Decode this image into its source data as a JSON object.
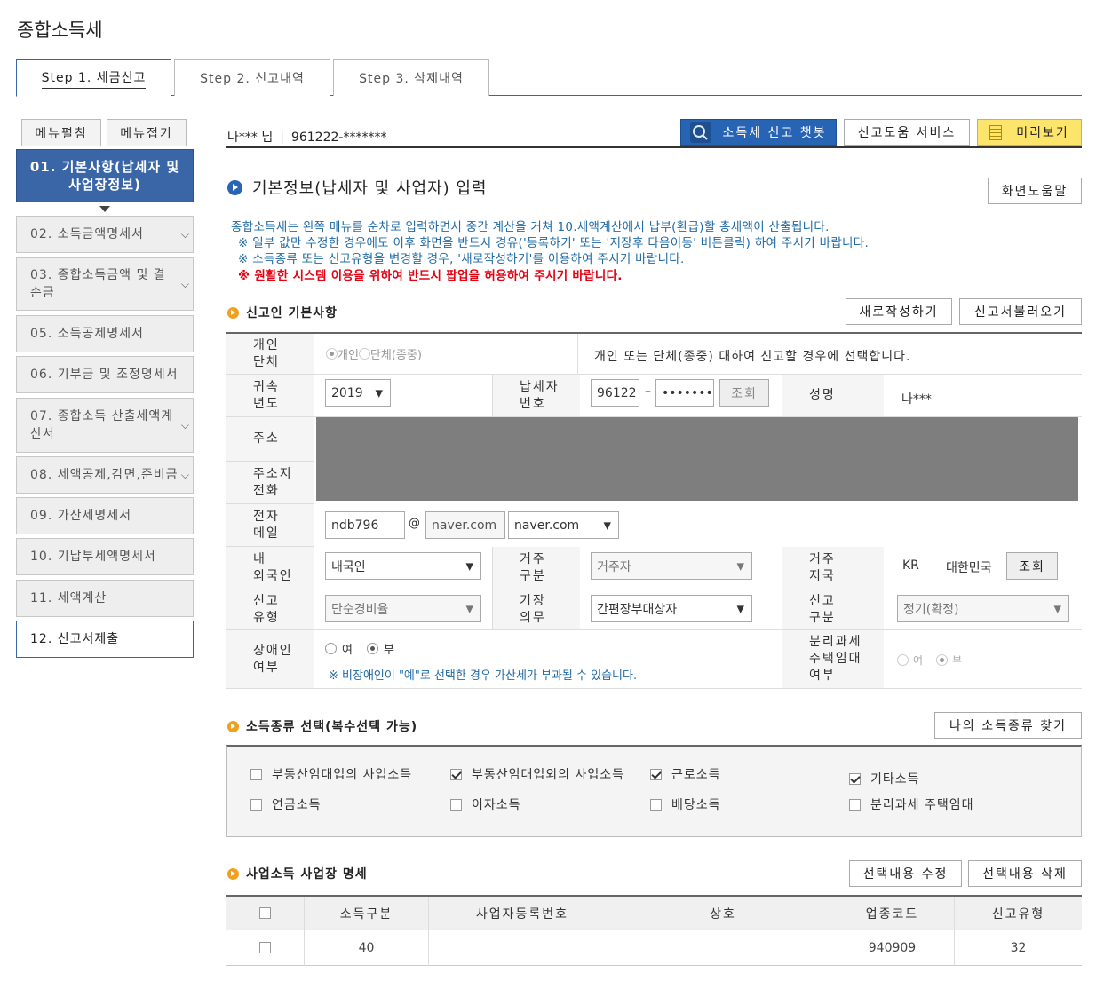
{
  "page": {
    "title": "종합소득세"
  },
  "steps": [
    "Step 1. 세금신고",
    "Step 2. 신고내역",
    "Step 3. 삭제내역"
  ],
  "sidebar": {
    "expand_all": "메뉴펼침",
    "collapse_all": "메뉴접기",
    "items": [
      {
        "label": "01. 기본사항(납세자 및 사업장정보)"
      },
      {
        "label": "02. 소득금액명세서"
      },
      {
        "label": "03. 종합소득금액 및 결손금"
      },
      {
        "label": "05. 소득공제명세서"
      },
      {
        "label": "06. 기부금 및 조정명세서"
      },
      {
        "label": "07. 종합소득 산출세액계산서"
      },
      {
        "label": "08. 세액공제,감면,준비금"
      },
      {
        "label": "09. 가산세명세서"
      },
      {
        "label": "10. 기납부세액명세서"
      },
      {
        "label": "11. 세액계산"
      },
      {
        "label": "12. 신고서제출"
      }
    ]
  },
  "userbar": {
    "name": "나***",
    "honorific": "님",
    "sep": "|",
    "id": "961222-*******"
  },
  "toolbar": {
    "chatbot": "소득세 신고 챗봇",
    "help_service": "신고도움 서비스",
    "preview": "미리보기"
  },
  "section_main": {
    "title": "기본정보(납세자 및 사업자) 입력",
    "screen_help": "화면도움말"
  },
  "notice": {
    "line1": "종합소득세는 왼쪽 메뉴를 순차로 입력하면서 중간 계산을 거쳐 10.세액계산에서 납부(환급)할 총세액이 산출됩니다.",
    "line2": "※ 일부 값만 수정한 경우에도 이후 화면을 반드시 경유('등록하기' 또는 '저장후 다음이동' 버튼클릭) 하여 주시기 바랍니다.",
    "line3": "※ 소득종류 또는 신고유형을 변경할 경우, '새로작성하기'를 이용하여 주시기 바랍니다.",
    "line4": "※ 원활한 시스템 이용을 위하여 반드시 팝업을 허용하여 주시기 바랍니다."
  },
  "section_reporter": {
    "title": "신고인 기본사항",
    "new_btn": "새로작성하기",
    "load_btn": "신고서불러오기"
  },
  "form": {
    "type_label": "개인\n단체",
    "type_opt1": "개인",
    "type_opt2": "단체(종중)",
    "type_desc": "개인 또는 단체(종중) 대하여 신고할 경우에 선택합니다.",
    "year_label": "귀속\n년도",
    "year_value": "2019",
    "taxpayer_label": "납세자\n번호",
    "taxpayer_front": "96122",
    "taxpayer_dash": "–",
    "taxpayer_back": "•••••••",
    "lookup": "조회",
    "name_label": "성명",
    "name_value": "나***",
    "address_label": "주소",
    "phone_label": "주소지\n전화",
    "email_label": "전자\n메일",
    "email_id": "ndb796",
    "email_at": "@",
    "email_domain": "naver.com",
    "email_domain_select": "naver.com",
    "foreign_label": "내\n외국인",
    "foreign_value": "내국인",
    "residence_label": "거주\n구분",
    "residence_value": "거주자",
    "region_label": "거주\n지국",
    "region_code": "KR",
    "region_name": "대한민국",
    "report_type_label": "신고\n유형",
    "report_type_value": "단순경비율",
    "bookkeeping_label": "기장\n의무",
    "bookkeeping_value": "간편장부대상자",
    "report_kind_label": "신고\n구분",
    "report_kind_value": "정기(확정)",
    "disabled_label": "장애인\n여부",
    "yes": "여",
    "no": "부",
    "disabled_note": "※ 비장애인이 \"예\"로 선택한 경우 가산세가 부과될 수 있습니다.",
    "separate_label": "분리과세\n주택임대\n여부"
  },
  "section_income": {
    "title": "소득종류 선택(복수선택 가능)",
    "find_btn": "나의 소득종류 찾기",
    "items": [
      {
        "label": "부동산임대업의 사업소득",
        "checked": false
      },
      {
        "label": "부동산임대업외의 사업소득",
        "checked": true
      },
      {
        "label": "근로소득",
        "checked": true
      },
      {
        "label": "기타소득",
        "checked": true
      },
      {
        "label": "연금소득",
        "checked": false
      },
      {
        "label": "이자소득",
        "checked": false
      },
      {
        "label": "배당소득",
        "checked": false
      },
      {
        "label": "분리과세 주택임대",
        "checked": false
      }
    ]
  },
  "section_business": {
    "title": "사업소득 사업장 명세",
    "edit_btn": "선택내용 수정",
    "delete_btn": "선택내용 삭제",
    "headers": [
      "소득구분",
      "사업자등록번호",
      "상호",
      "업종코드",
      "신고유형"
    ],
    "rows": [
      {
        "income_type": "40",
        "biz_no": "",
        "name": "",
        "industry": "940909",
        "report_type": "32"
      }
    ]
  },
  "colors": {
    "accent": "#3a66a7",
    "chatbot": "#2864b4",
    "preview": "#fce56a",
    "notice": "#1f6aa6",
    "warning": "#e60012"
  }
}
